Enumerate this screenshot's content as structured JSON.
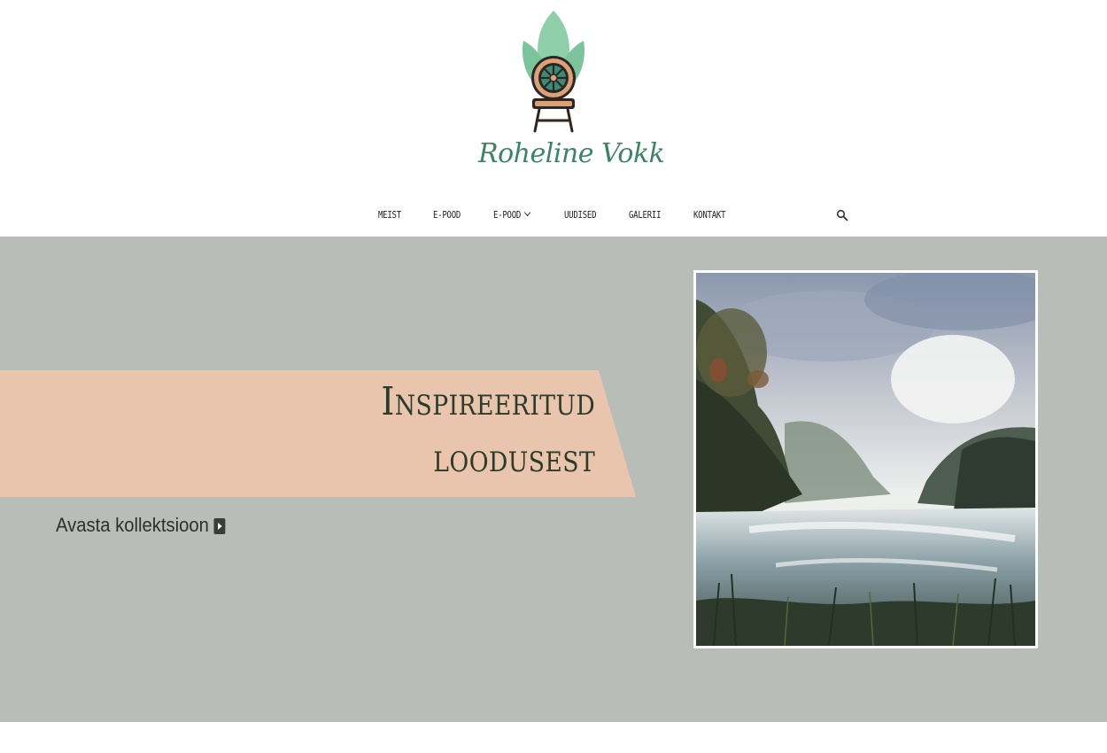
{
  "header": {
    "logo_text": "Roheline Vokk"
  },
  "nav": {
    "items": [
      {
        "label": "MEIST"
      },
      {
        "label": "E-POOD"
      },
      {
        "label": "E-POOD"
      },
      {
        "label": "UUDISED"
      },
      {
        "label": "GALERII"
      },
      {
        "label": "KONTAKT"
      }
    ],
    "search_icon": "search-icon"
  },
  "hero": {
    "title_line1": "Inspireeritud",
    "title_line2": "loodusest",
    "cta_label": "Avasta kollektsioon",
    "cta_icon": "play-square-icon"
  },
  "colors": {
    "hero_background": "#b9bdb7",
    "banner": "#e9c5ae",
    "title_text": "#2e3a2a",
    "logo_green": "#3f8462",
    "leaf_green": "#8fcfa9"
  }
}
